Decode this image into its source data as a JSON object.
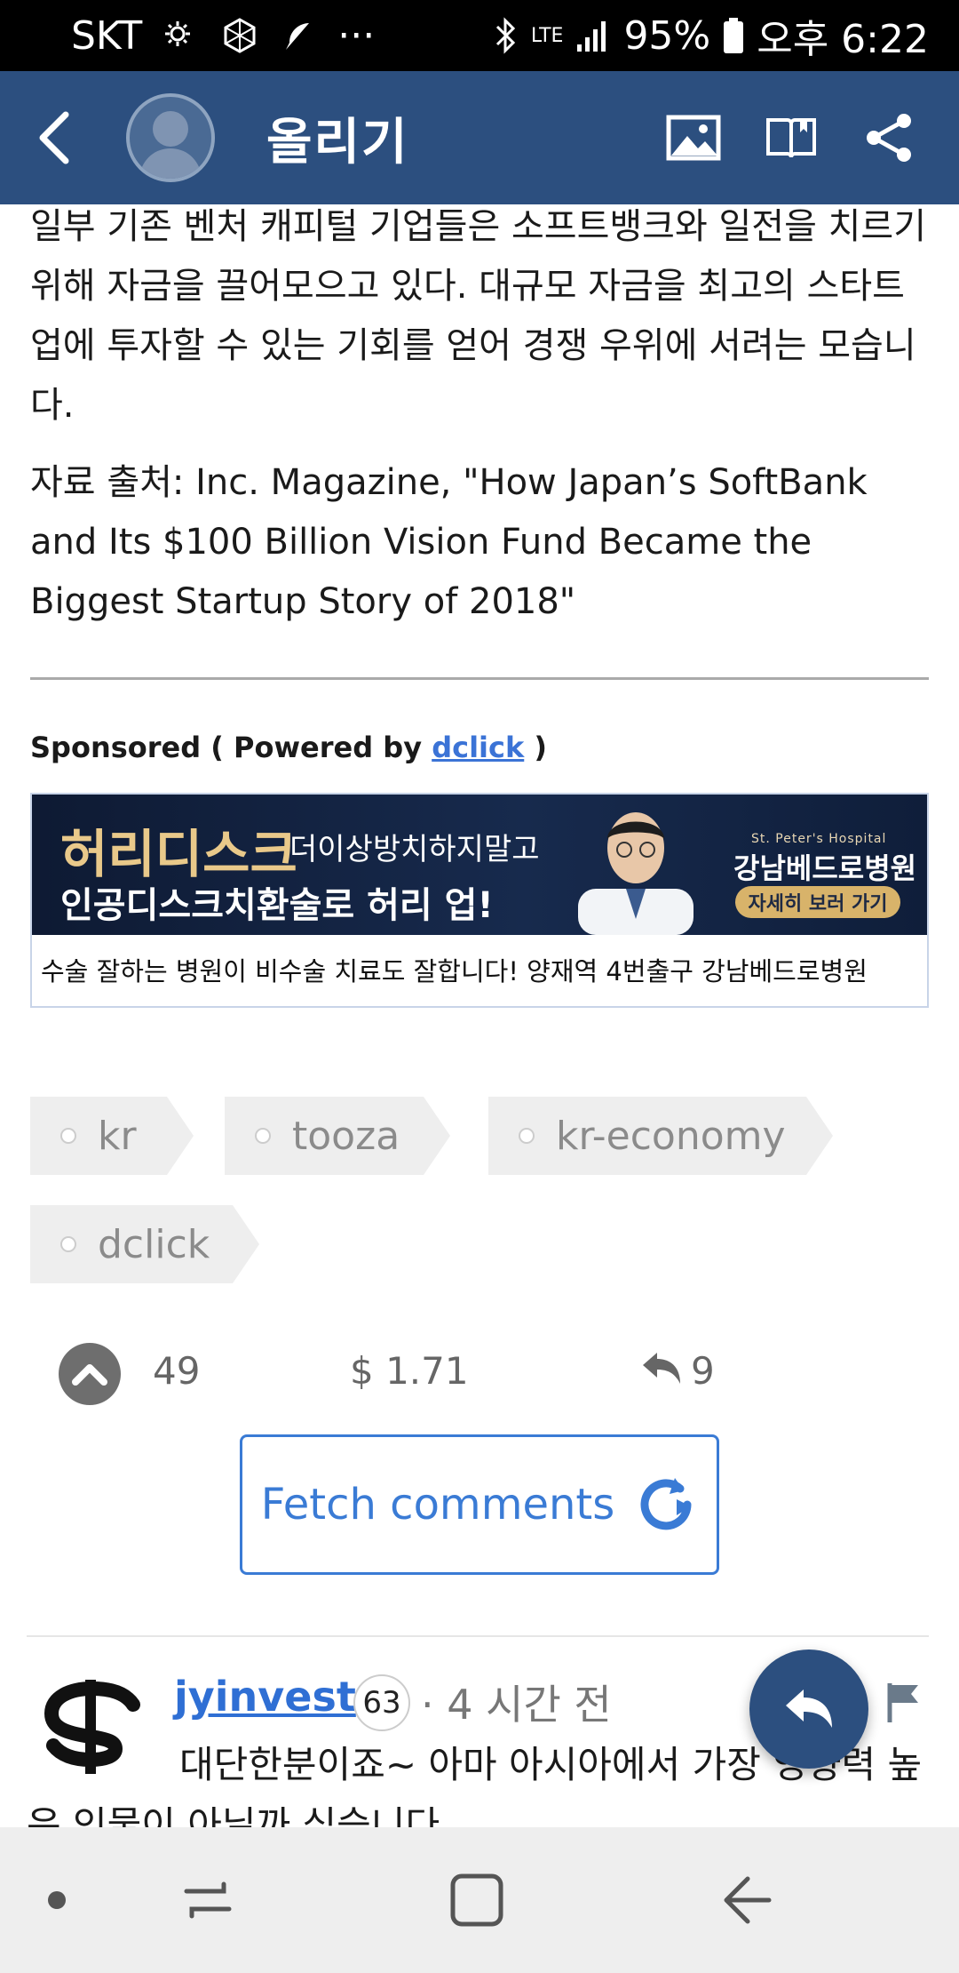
{
  "status_bar": {
    "carrier": "SKT",
    "network": "LTE",
    "battery": "95%",
    "time": "오후 6:22",
    "more": "···"
  },
  "app_bar": {
    "title": "올리기"
  },
  "article": {
    "paragraph1": "일부 기존 벤처 캐피털 기업들은 소프트뱅크와 일전을 치르기 위해 자금을 끌어모으고 있다. 대규모 자금을 최고의 스타트업에 투자할 수 있는 기회를 얻어 경쟁 우위에 서려는 모습니다.",
    "paragraph2": "자료 출처: Inc. Magazine, \"How Japan’s SoftBank and Its $100 Billion Vision Fund Became the Biggest Startup Story of 2018\""
  },
  "sponsored": {
    "prefix": "Sponsored ( Powered by ",
    "link": "dclick",
    "suffix": " )"
  },
  "ad": {
    "headline_big": "허리디스크",
    "headline_small": "더이상방치하지말고",
    "headline2": "인공디스크치환술로 허리 업!",
    "hospital_en": "St. Peter's Hospital",
    "hospital": "강남베드로병원",
    "cta": "자세히 보러 가기",
    "caption": "수술 잘하는 병원이 비수술 치료도 잘합니다! 양재역 4번출구 강남베드로병원"
  },
  "tags": [
    "kr",
    "tooza",
    "kr-economy",
    "dclick"
  ],
  "stats": {
    "votes": "49",
    "payout": "$ 1.71",
    "replies": "9"
  },
  "fetch_comments": {
    "label": "Fetch comments"
  },
  "comment": {
    "author": "jyinvest",
    "reputation": "63",
    "time": "· 4 시간 전",
    "body": "대단한분이죠~ 아마 아시아에서 가장 영향력 높은 인물이 아닐까 싶습니다"
  },
  "icons": {
    "back": "back-arrow-icon",
    "image": "image-icon",
    "book": "book-icon",
    "share": "share-icon",
    "upvote": "upvote-icon",
    "reply": "reply-icon",
    "refresh": "refresh-icon",
    "flag": "flag-icon"
  },
  "colors": {
    "app_bar": "#2c4f7f",
    "link": "#3a7bd5",
    "tag_bg": "#eeeeee"
  }
}
